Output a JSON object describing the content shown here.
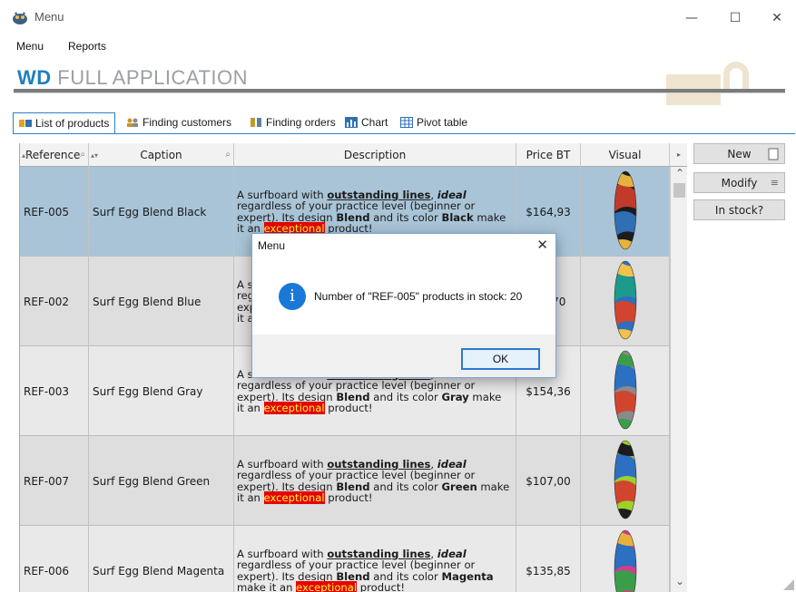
{
  "window": {
    "title": "Menu",
    "minimize": "—",
    "maximize": "☐",
    "close": "✕"
  },
  "menubar": {
    "items": [
      {
        "label": "Menu"
      },
      {
        "label": "Reports"
      }
    ]
  },
  "banner": {
    "brand_prefix": "WD",
    "brand_rest": " FULL APPLICATION"
  },
  "tabs": [
    {
      "label": "List of products",
      "icon": "products-icon",
      "active": true
    },
    {
      "label": "Finding customers",
      "icon": "customers-icon"
    },
    {
      "label": "Finding orders",
      "icon": "orders-icon"
    },
    {
      "label": "Chart",
      "icon": "chart-icon"
    },
    {
      "label": "Pivot table",
      "icon": "pivot-table-icon"
    }
  ],
  "table": {
    "columns": [
      "Reference",
      "Caption",
      "Description",
      "Price BT",
      "Visual"
    ],
    "rows": [
      {
        "reference": "REF-005",
        "caption": "Surf Egg Blend Black",
        "desc": {
          "p1": "A surfboard with ",
          "b1": "outstanding lines",
          "p2": ", ",
          "i1": "ideal",
          "p3": " regardless of your practice level (beginner or expert). Its design ",
          "b2": "Blend",
          "p4": " and its color ",
          "b3": "Black",
          "p5": " make it an ",
          "h": "exceptional",
          "p6": " product!"
        },
        "price": "$164,93",
        "selected": true,
        "board_colors": [
          "#1c1c1c",
          "#c23a2a",
          "#2f6fb3",
          "#e7b23c"
        ]
      },
      {
        "reference": "REF-002",
        "caption": "Surf Egg Blend Blue",
        "desc": {
          "p1": "A surfboard with ",
          "b1": "outstanding lines",
          "p2": ", ",
          "i1": "ideal",
          "p3": " regardless of your practice level (beginner or expert). Its design ",
          "b2": "Blend",
          "p4": " and its color ",
          "b3": "Blue",
          "p5": " make it an ",
          "h": "exceptional",
          "p6": " product!"
        },
        "price": "$…,70",
        "board_colors": [
          "#2d6fc0",
          "#1b9a8c",
          "#d1452f",
          "#f0c24b"
        ]
      },
      {
        "reference": "REF-003",
        "caption": "Surf Egg Blend Gray",
        "desc": {
          "p1": "A surfboard with ",
          "b1": "outstanding lines",
          "p2": ", ",
          "i1": "ideal",
          "p3": " regardless of your practice level (beginner or expert). Its design ",
          "b2": "Blend",
          "p4": " and its color ",
          "b3": "Gray",
          "p5": " make it an ",
          "h": "exceptional",
          "p6": " product!"
        },
        "price": "$154,36",
        "board_colors": [
          "#8a8a8a",
          "#2d6fc0",
          "#d1452f",
          "#3b9c4a"
        ]
      },
      {
        "reference": "REF-007",
        "caption": "Surf Egg Blend Green",
        "desc": {
          "p1": "A surfboard with ",
          "b1": "outstanding lines",
          "p2": ", ",
          "i1": "ideal",
          "p3": " regardless of your practice level (beginner or expert). Its design ",
          "b2": "Blend",
          "p4": " and its color ",
          "b3": "Green",
          "p5": " make it an ",
          "h": "exceptional",
          "p6": " product!"
        },
        "price": "$107,00",
        "board_colors": [
          "#9bd12a",
          "#2d6fc0",
          "#d1452f",
          "#1c1c1c"
        ]
      },
      {
        "reference": "REF-006",
        "caption": "Surf Egg Blend Magenta",
        "desc": {
          "p1": "A surfboard with ",
          "b1": "outstanding lines",
          "p2": ", ",
          "i1": "ideal",
          "p3": " regardless of your practice level (beginner or expert). Its design ",
          "b2": "Blend",
          "p4": " and its color ",
          "b3": "Magenta",
          "p5": " make it an ",
          "h": "exceptional",
          "p6": " product!"
        },
        "price": "$135,85",
        "board_colors": [
          "#d43c8a",
          "#2d6fc0",
          "#3b9c4a",
          "#e7b23c"
        ]
      }
    ]
  },
  "side_buttons": {
    "new": "New",
    "modify": "Modify",
    "in_stock": "In stock?"
  },
  "dialog": {
    "title": "Menu",
    "close": "✕",
    "icon": "i",
    "message": "Number of \"REF-005\" products in stock: 20",
    "ok": "OK"
  },
  "colors": {
    "accent": "#2a82c8",
    "selected_row": "#a9c4d7",
    "highlight_bg": "#e60000",
    "highlight_fg": "#ffff33"
  }
}
